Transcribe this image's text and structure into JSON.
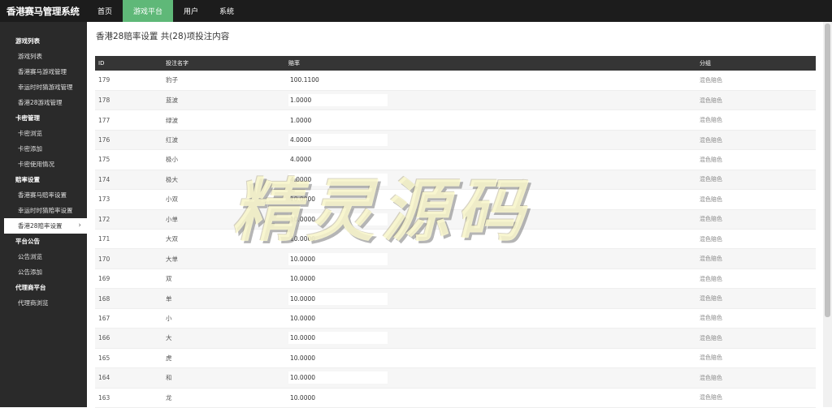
{
  "app": {
    "title": "香港赛马管理系统"
  },
  "topnav": [
    {
      "label": "首页",
      "active": false
    },
    {
      "label": "游戏平台",
      "active": true
    },
    {
      "label": "用户",
      "active": false
    },
    {
      "label": "系统",
      "active": false
    }
  ],
  "sidebar": {
    "groups": [
      {
        "label": "游戏列表",
        "items": [
          {
            "label": "游戏列表"
          },
          {
            "label": "香港赛马游戏管理"
          },
          {
            "label": "幸运时时猜游戏管理"
          },
          {
            "label": "香港28游戏管理"
          }
        ]
      },
      {
        "label": "卡密管理",
        "items": [
          {
            "label": "卡密浏览"
          },
          {
            "label": "卡密添加"
          },
          {
            "label": "卡密使用情况"
          }
        ]
      },
      {
        "label": "赔率设置",
        "items": [
          {
            "label": "香港赛马赔率设置"
          },
          {
            "label": "幸运时时猜赔率设置"
          },
          {
            "label": "香港28赔率设置",
            "active": true
          }
        ]
      },
      {
        "label": "平台公告",
        "items": [
          {
            "label": "公告浏览"
          },
          {
            "label": "公告添加"
          }
        ]
      },
      {
        "label": "代理商平台",
        "items": [
          {
            "label": "代理商浏览"
          }
        ]
      }
    ],
    "active_chevron": "chevron-right-icon"
  },
  "main": {
    "title": "香港28赔率设置 共(28)项投注内容",
    "columns": [
      "ID",
      "投注名字",
      "赔率",
      "分组"
    ],
    "rows": [
      {
        "id": "179",
        "name": "豹子",
        "odds": "100.1100",
        "group": "混色赔色"
      },
      {
        "id": "178",
        "name": "蓝波",
        "odds": "1.0000",
        "group": "混色赔色"
      },
      {
        "id": "177",
        "name": "绿波",
        "odds": "1.0000",
        "group": "混色赔色"
      },
      {
        "id": "176",
        "name": "红波",
        "odds": "4.0000",
        "group": "混色赔色"
      },
      {
        "id": "175",
        "name": "极小",
        "odds": "4.0000",
        "group": "混色赔色"
      },
      {
        "id": "174",
        "name": "极大",
        "odds": "4.0000",
        "group": "混色赔色"
      },
      {
        "id": "173",
        "name": "小双",
        "odds": "10.0000",
        "group": "混色赔色"
      },
      {
        "id": "172",
        "name": "小单",
        "odds": "10.0000",
        "group": "混色赔色"
      },
      {
        "id": "171",
        "name": "大双",
        "odds": "10.0000",
        "group": "混色赔色"
      },
      {
        "id": "170",
        "name": "大单",
        "odds": "10.0000",
        "group": "混色赔色"
      },
      {
        "id": "169",
        "name": "双",
        "odds": "10.0000",
        "group": "混色赔色"
      },
      {
        "id": "168",
        "name": "单",
        "odds": "10.0000",
        "group": "混色赔色"
      },
      {
        "id": "167",
        "name": "小",
        "odds": "10.0000",
        "group": "混色赔色"
      },
      {
        "id": "166",
        "name": "大",
        "odds": "10.0000",
        "group": "混色赔色"
      },
      {
        "id": "165",
        "name": "虎",
        "odds": "10.0000",
        "group": "混色赔色"
      },
      {
        "id": "164",
        "name": "和",
        "odds": "10.0000",
        "group": "混色赔色"
      },
      {
        "id": "163",
        "name": "龙",
        "odds": "10.0000",
        "group": "混色赔色"
      }
    ]
  },
  "watermark": {
    "text": "精灵源码"
  },
  "colors": {
    "topbar": "#1c1c1c",
    "sidebar": "#2a2a2a",
    "accent": "#5fb878",
    "table_header": "#353535"
  }
}
